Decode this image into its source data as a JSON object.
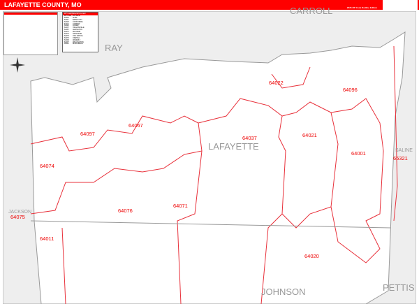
{
  "header": {
    "title": "LAFAYETTE COUNTY, MO",
    "edition": "2026 ZIP Code Redline Edition"
  },
  "zip_table": {
    "title": "ZIP Code/Name/Grid Locator",
    "columns": [
      "ZIP Code",
      "ZIP Name"
    ],
    "rows": [
      [
        "64001",
        "ALMA"
      ],
      [
        "64011",
        "BATES CITY"
      ],
      [
        "64020",
        "CONCORDIA"
      ],
      [
        "64021",
        "CORDER"
      ],
      [
        "64022",
        "DOVER"
      ],
      [
        "64037",
        "HIGGINSVILLE"
      ],
      [
        "64067",
        "LEXINGTON"
      ],
      [
        "64071",
        "MAYVIEW"
      ],
      [
        "64074",
        "NAPOLEON"
      ],
      [
        "64075",
        "OAK GROVE"
      ],
      [
        "64076",
        "ODESSA"
      ],
      [
        "64096",
        "WAVERLY"
      ],
      [
        "64097",
        "WELLINGTON"
      ],
      [
        "65321",
        "BLACKBURN"
      ]
    ]
  },
  "counties": {
    "carroll": "CARROLL",
    "ray": "RAY",
    "lafayette": "LAFAYETTE",
    "johnson": "JOHNSON",
    "pettis": "PETTIS",
    "saline": "SALINE",
    "jackson": "JACKSON"
  },
  "zip_labels": {
    "z64022": "64022",
    "z64096": "64096",
    "z64067": "64067",
    "z64097": "64097",
    "z64037": "64037",
    "z64021": "64021",
    "z64001": "64001",
    "z65321": "65321",
    "z64074": "64074",
    "z64076": "64076",
    "z64071": "64071",
    "z64075": "64075",
    "z64011": "64011",
    "z64020": "64020"
  },
  "colors": {
    "header": "#ff0000",
    "zip_boundary": "#e8303a",
    "county_bg": "#eeeeee"
  }
}
